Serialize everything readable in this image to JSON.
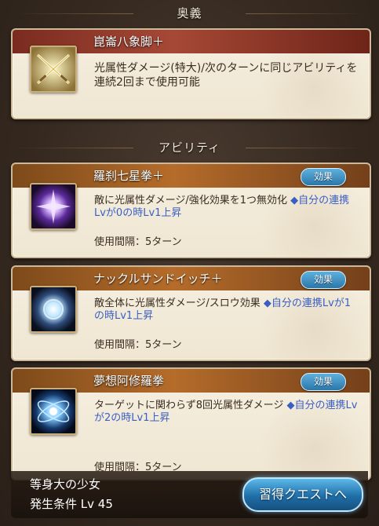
{
  "sections": {
    "ougi_title": "奥義",
    "ability_title": "アビリティ"
  },
  "ougi": {
    "name": "崑崙八象脚＋",
    "description": "光属性ダメージ(特大)/次のターンに同じアビリティを連続2回まで使用可能",
    "icon": "crossed-swords-icon"
  },
  "abilities": [
    {
      "name": "羅刹七星拳＋",
      "effect_label": "効果",
      "description": "敵に光属性ダメージ/強化効果を1つ無効化",
      "link": "◆自分の連携Lvが0の時Lv1上昇",
      "interval": "使用間隔：5ターン",
      "icon": "purple-burst-icon"
    },
    {
      "name": "ナックルサンドイッチ＋",
      "effect_label": "効果",
      "description": "敵全体に光属性ダメージ/スロウ効果",
      "link": "◆自分の連携Lvが1の時Lv1上昇",
      "interval": "使用間隔：5ターン",
      "icon": "light-orb-icon"
    },
    {
      "name": "夢想阿修羅拳",
      "effect_label": "効果",
      "description": "ターゲットに関わらず8回光属性ダメージ",
      "link": "◆自分の連携Lvが2の時Lv1上昇",
      "interval": "使用間隔：5ターン",
      "icon": "blue-orbit-icon"
    }
  ],
  "bottom": {
    "ability_source": "等身大の少女",
    "condition": "発生条件 Lv 45",
    "quest_button": "習得クエストへ"
  },
  "colors": {
    "ougi_header": "#a64836",
    "ability_header": "#b56c2a",
    "effect_button": "#2a77aa",
    "link_text": "#3a5fc4"
  }
}
